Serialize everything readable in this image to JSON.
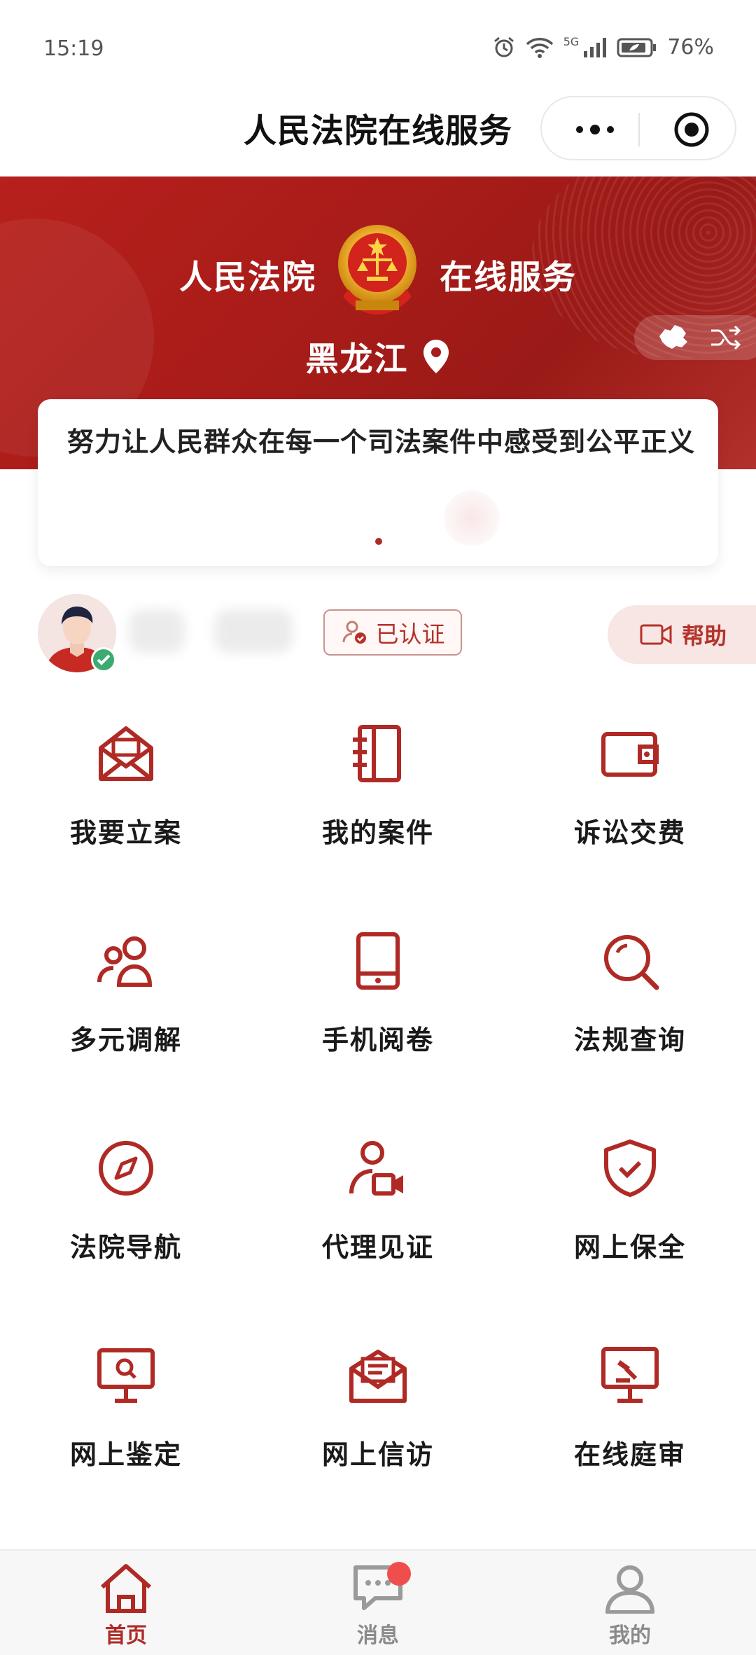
{
  "status_bar": {
    "time": "15:19",
    "network": "5G",
    "battery": "76%"
  },
  "header": {
    "title": "人民法院在线服务"
  },
  "banner": {
    "left_text": "人民法院",
    "right_text": "在线服务",
    "region": "黑龙江"
  },
  "slogan": {
    "text": "努力让人民群众在每一个司法案件中感受到公平正义"
  },
  "user": {
    "verified_label": "已认证",
    "help_label": "帮助"
  },
  "services": [
    {
      "label": "我要立案",
      "icon": "envelope-open-icon"
    },
    {
      "label": "我的案件",
      "icon": "case-book-icon"
    },
    {
      "label": "诉讼交费",
      "icon": "wallet-icon"
    },
    {
      "label": "多元调解",
      "icon": "people-icon"
    },
    {
      "label": "手机阅卷",
      "icon": "phone-icon"
    },
    {
      "label": "法规查询",
      "icon": "search-icon"
    },
    {
      "label": "法院导航",
      "icon": "compass-icon"
    },
    {
      "label": "代理见证",
      "icon": "user-video-icon"
    },
    {
      "label": "网上保全",
      "icon": "shield-check-icon"
    },
    {
      "label": "网上鉴定",
      "icon": "monitor-search-icon"
    },
    {
      "label": "网上信访",
      "icon": "letter-icon"
    },
    {
      "label": "在线庭审",
      "icon": "courtroom-screen-icon"
    }
  ],
  "tabbar": [
    {
      "label": "首页",
      "icon": "home-icon",
      "active": true
    },
    {
      "label": "消息",
      "icon": "message-icon",
      "active": false
    },
    {
      "label": "我的",
      "icon": "profile-icon",
      "active": false
    }
  ],
  "colors": {
    "brand_red": "#b02a25",
    "banner_red": "#a91c19",
    "tab_inactive": "#9a9a9a",
    "notify_red": "#f04d4d"
  }
}
